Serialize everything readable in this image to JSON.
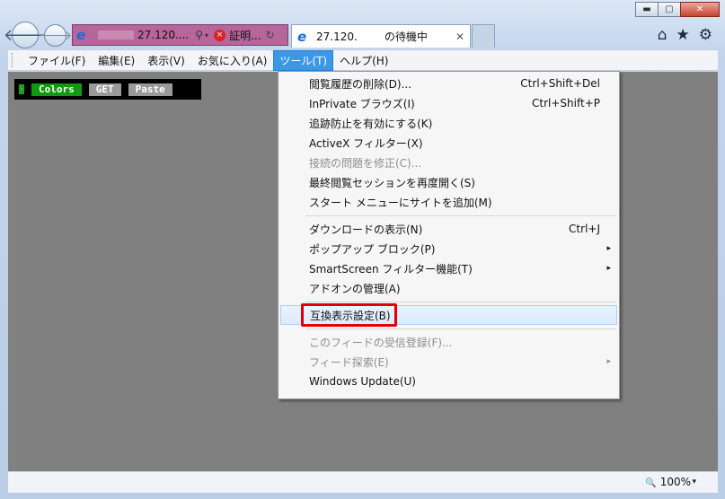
{
  "window": {
    "minimize": "▬",
    "maximize": "▢",
    "close": "✕"
  },
  "nav": {
    "back_icon": "🡐",
    "forward_icon": "🡒"
  },
  "address_bar": {
    "ie_logo": "e",
    "url_text": "27.120....",
    "cert_error_text": "証明...",
    "search_glyph": "⚲",
    "dropdown_glyph": "▾",
    "error_glyph": "×",
    "refresh_glyph": "↻"
  },
  "tab": {
    "ie_logo": "e",
    "title_part1": "27.120.",
    "title_part2": "の待機中",
    "close_glyph": "✕"
  },
  "toolbar_icons": {
    "home": "⌂",
    "favorites": "★",
    "settings": "⚙"
  },
  "menubar": {
    "items": [
      {
        "label": "ファイル(F)"
      },
      {
        "label": "編集(E)"
      },
      {
        "label": "表示(V)"
      },
      {
        "label": "お気に入り(A)"
      },
      {
        "label": "ツール(T)",
        "active": true
      },
      {
        "label": "ヘルプ(H)"
      }
    ]
  },
  "page_toolbox": {
    "dot": "·",
    "colors": "Colors",
    "get": "GET",
    "paste": "Paste"
  },
  "tools_menu": {
    "items": [
      {
        "label": "閲覧履歴の削除(D)...",
        "shortcut": "Ctrl+Shift+Del"
      },
      {
        "label": "InPrivate ブラウズ(I)",
        "shortcut": "Ctrl+Shift+P"
      },
      {
        "label": "追跡防止を有効にする(K)"
      },
      {
        "label": "ActiveX フィルター(X)"
      },
      {
        "label": "接続の問題を修正(C)...",
        "disabled": true
      },
      {
        "label": "最終閲覧セッションを再度開く(S)"
      },
      {
        "label": "スタート メニューにサイトを追加(M)"
      },
      {
        "label": "ダウンロードの表示(N)",
        "shortcut": "Ctrl+J"
      },
      {
        "label": "ポップアップ ブロック(P)",
        "submenu": "▸"
      },
      {
        "label": "SmartScreen フィルター機能(T)",
        "submenu": "▸"
      },
      {
        "label": "アドオンの管理(A)"
      },
      {
        "label": "互換表示設定(B)",
        "highlighted": true
      },
      {
        "label": "このフィードの受信登録(F)...",
        "disabled": true
      },
      {
        "label": "フィード探索(E)",
        "disabled": true,
        "submenu": "▸"
      },
      {
        "label": "Windows Update(U)"
      }
    ]
  },
  "statusbar": {
    "zoom_icon": "🔍",
    "zoom_level": "100%",
    "zoom_dropdown": "▾"
  },
  "colors": {
    "menu_active": "#3a98e6",
    "highlight_box": "#e00000",
    "address_bar_error": "#b6669a",
    "toolbox_green": "#119911"
  }
}
